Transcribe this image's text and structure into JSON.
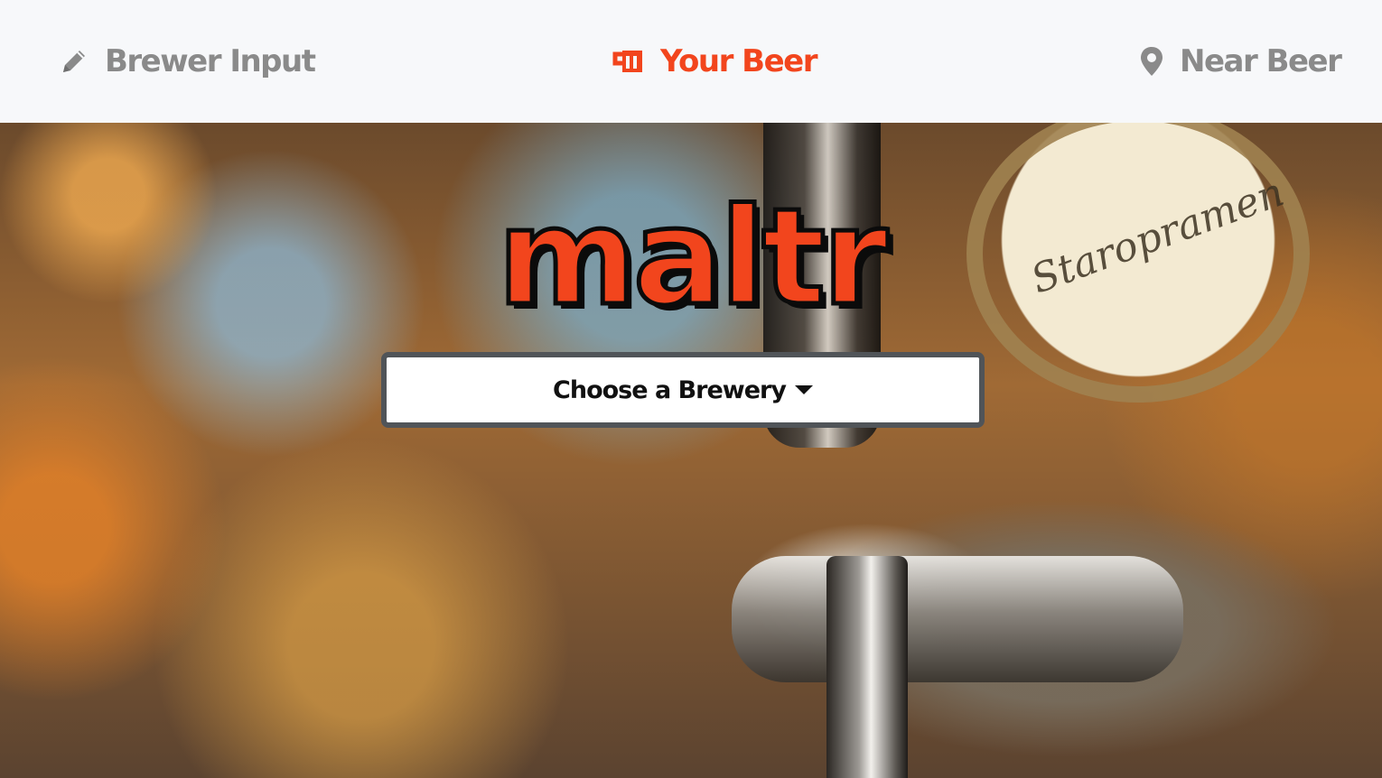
{
  "nav": {
    "items": [
      {
        "label": "Brewer Input",
        "icon": "pencil-icon",
        "active": false
      },
      {
        "label": "Your Beer",
        "icon": "beer-mug-icon",
        "active": true
      },
      {
        "label": "Near Beer",
        "icon": "map-pin-icon",
        "active": false
      }
    ]
  },
  "hero": {
    "logo_text": "maltr",
    "background": "blurred beer taps photo",
    "medallion_text": "Staropramen"
  },
  "brewery_dropdown": {
    "label": "Choose a Brewery"
  },
  "colors": {
    "accent": "#f2451d",
    "nav_inactive": "#8a8a8a",
    "navbar_bg": "#f7f8fa"
  }
}
